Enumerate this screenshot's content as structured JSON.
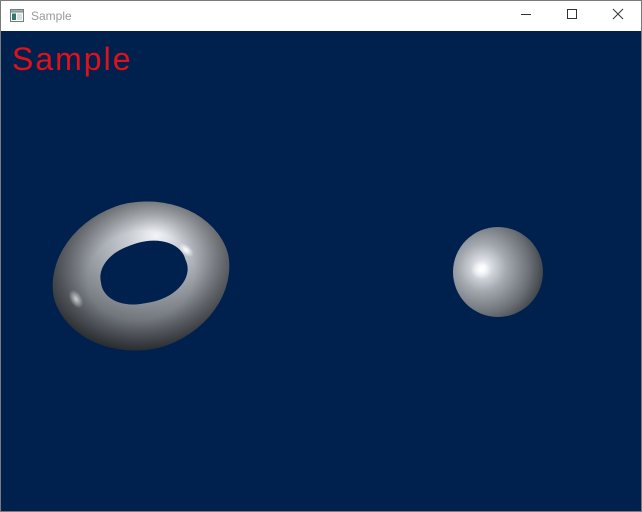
{
  "window": {
    "title": "Sample"
  },
  "title_bar": {
    "icon": "app-window-icon",
    "buttons": [
      {
        "name": "minimize",
        "icon": "minimize-icon"
      },
      {
        "name": "maximize",
        "icon": "maximize-icon"
      },
      {
        "name": "close",
        "icon": "close-icon"
      }
    ]
  },
  "scene": {
    "overlay_text": "Sample",
    "overlay_color": "#e0111a",
    "background_color": "#00214d",
    "objects": [
      {
        "name": "torus",
        "material": "brushed-metal"
      },
      {
        "name": "sphere",
        "material": "brushed-metal"
      }
    ]
  }
}
